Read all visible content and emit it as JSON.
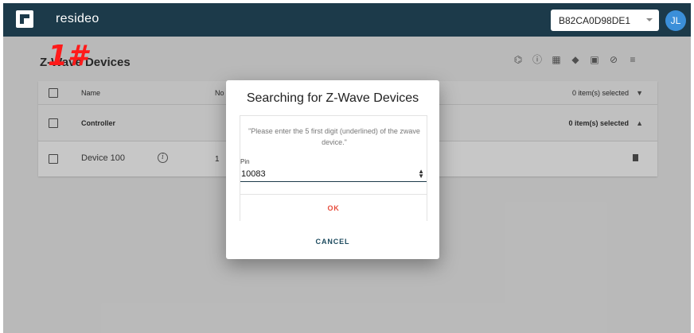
{
  "header": {
    "brand": "resideo",
    "device_id": "B82CA0D98DE1",
    "avatar_initials": "JL",
    "bar_color": "#1c3a4a"
  },
  "page": {
    "title": "Z-Wave Devices",
    "toolbar_icons": [
      "network-icon",
      "alert-icon",
      "factory-icon",
      "graduation-cap-icon",
      "device-icon",
      "block-icon",
      "playlist-add-icon"
    ]
  },
  "table": {
    "header": {
      "name": "Name",
      "node": "No",
      "selected": "0 item(s) selected"
    },
    "group": {
      "name": "Controller",
      "selected": "0 item(s) selected"
    },
    "rows": [
      {
        "name": "Device 100",
        "node": "1"
      }
    ]
  },
  "annotation": "1#",
  "dialog": {
    "title": "Searching for Z-Wave Devices",
    "instruction": "\"Please enter the 5 first digit (underlined) of the zwave device.\"",
    "pin_label": "Pin",
    "pin_value": "10083",
    "ok_label": "OK",
    "cancel_label": "CANCEL",
    "ok_color": "#e74c3c"
  }
}
